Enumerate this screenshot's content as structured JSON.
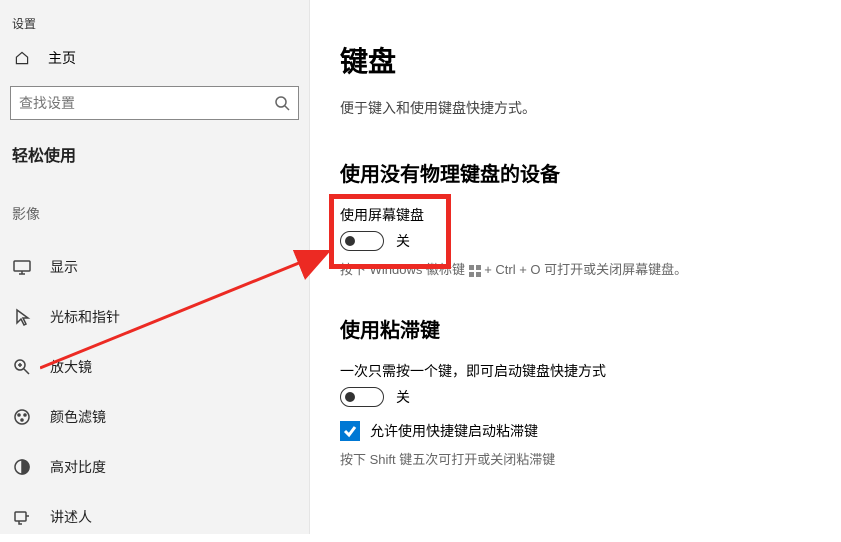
{
  "window": {
    "title": "设置"
  },
  "sidebar": {
    "home": "主页",
    "search_placeholder": "查找设置",
    "category": "轻松使用",
    "section": "影像",
    "items": [
      {
        "label": "显示"
      },
      {
        "label": "光标和指针"
      },
      {
        "label": "放大镜"
      },
      {
        "label": "颜色滤镜"
      },
      {
        "label": "高对比度"
      },
      {
        "label": "讲述人"
      }
    ]
  },
  "main": {
    "title": "键盘",
    "desc": "便于键入和使用键盘快捷方式。",
    "section1": {
      "heading": "使用没有物理键盘的设备",
      "toggle_label": "使用屏幕键盘",
      "toggle_state": "关",
      "hint_pre": "按下 Windows 徽标键 ",
      "hint_post": " + Ctrl + O 可打开或关闭屏幕键盘。"
    },
    "section2": {
      "heading": "使用粘滞键",
      "toggle_label": "一次只需按一个键，即可启动键盘快捷方式",
      "toggle_state": "关",
      "checkbox_label": "允许使用快捷键启动粘滞键",
      "hint": "按下 Shift 键五次可打开或关闭粘滞键"
    }
  }
}
